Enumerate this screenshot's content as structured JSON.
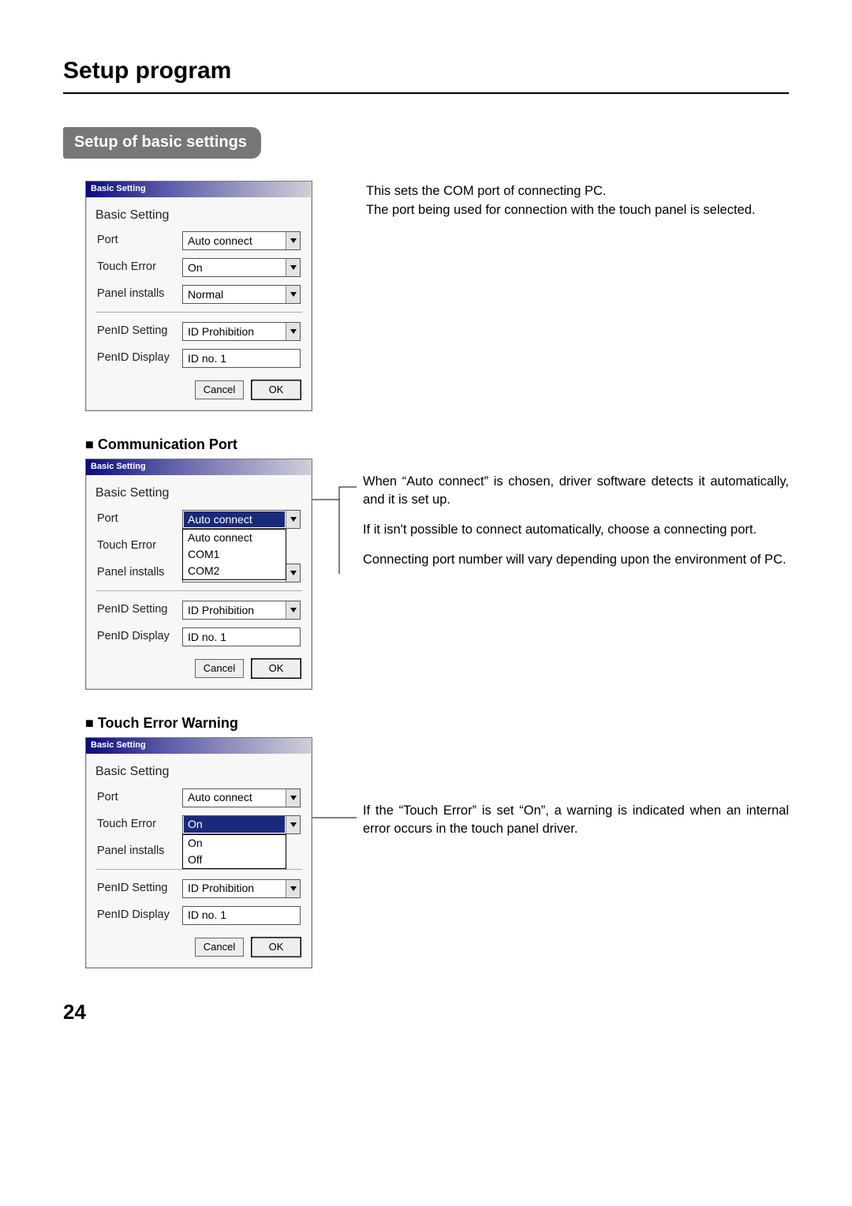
{
  "page": {
    "title": "Setup program",
    "section": "Setup of basic settings",
    "number": "24"
  },
  "dialog_common": {
    "titlebar": "Basic Setting",
    "group_title": "Basic Setting",
    "labels": {
      "port": "Port",
      "touch_error": "Touch Error",
      "panel_installs": "Panel installs",
      "penid_setting": "PenID Setting",
      "penid_display": "PenID Display"
    },
    "values": {
      "port": "Auto connect",
      "touch_error": "On",
      "panel_installs": "Normal",
      "penid_setting": "ID Prohibition",
      "penid_display": "ID no. 1"
    },
    "buttons": {
      "cancel": "Cancel",
      "ok": "OK"
    }
  },
  "port_dropdown_options": [
    "Auto connect",
    "COM1",
    "COM2"
  ],
  "toucherror_dropdown_options": [
    "On",
    "Off"
  ],
  "descriptions": {
    "intro1": "This sets the COM port of connecting PC.",
    "intro2": "The port being used for connection with the touch panel is selected.",
    "comm1": "When “Auto connect” is chosen, driver software detects it automatically, and it is set up.",
    "comm2": "If it isn't possible to connect automatically, choose a connecting port.",
    "comm3": "Connecting port number will vary depending upon the environment of PC.",
    "toucherr": "If the “Touch Error” is set “On”, a warning is indicated when an internal error occurs in the touch panel driver."
  },
  "subheadings": {
    "comm": "Communication Port",
    "toucherr": "Touch Error Warning"
  }
}
